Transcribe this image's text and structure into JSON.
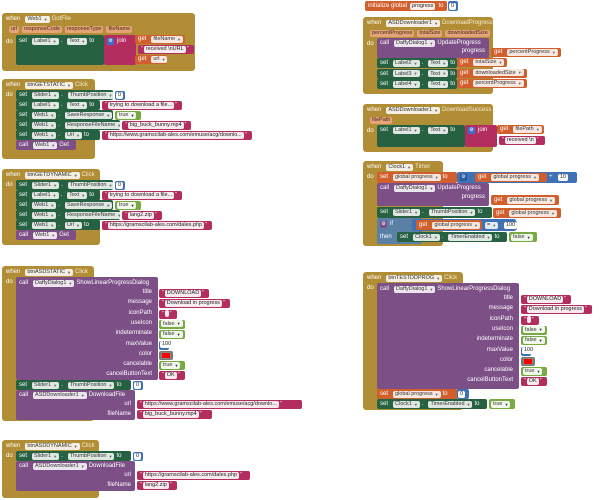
{
  "colors": {
    "event": "#b18e35",
    "setter": "#266141",
    "call": "#7d4f87",
    "text": "#b32d5e",
    "variable": "#d05f2d",
    "math": "#3f71b5",
    "logic": "#77ab41",
    "color_red": "#ff0000"
  },
  "kw": {
    "when": "when",
    "do": "do",
    "set": "set",
    "to": "to",
    "call": "call",
    "get": "get",
    "join": "join",
    "then": "then",
    "if": "if",
    "dot": ".",
    "quote": "\"",
    "initialize_global": "initialize global",
    "plus": "+",
    "eq": "="
  },
  "web_gotfile": {
    "component": "Web1",
    "event": "GotFile",
    "params": [
      "url",
      "responseCode",
      "responseType",
      "fileName"
    ],
    "set_component": "Label1",
    "set_property": "Text",
    "join_items": [
      {
        "type": "get",
        "value": "fileName"
      },
      {
        "type": "text",
        "value": "received \\nURL"
      },
      {
        "type": "get",
        "value": "url"
      }
    ]
  },
  "btn_get_static": {
    "component": "btnGETSTATIC",
    "event": "Click",
    "statements": [
      {
        "component": "Slider1",
        "property": "ThumbPosition",
        "value": "0",
        "type": "number"
      },
      {
        "component": "Label1",
        "property": "Text",
        "value": "trying to download a file...",
        "type": "text"
      },
      {
        "component": "Web1",
        "property": "SaveResponse",
        "value": "true",
        "type": "bool"
      },
      {
        "component": "Web1",
        "property": "ResponseFileName",
        "value": "big_buck_bunny.mp4",
        "type": "text"
      },
      {
        "component": "Web1",
        "property": "Url",
        "value": "https://www.gramscilab-ales.com/emuse/acg/downlo...",
        "type": "text"
      }
    ],
    "call_component": "Web1",
    "call_method": "Get"
  },
  "btn_get_dynamic": {
    "component": "btnGETDYNAMIC",
    "event": "Click",
    "statements": [
      {
        "component": "Slider1",
        "property": "ThumbPosition",
        "value": "0",
        "type": "number"
      },
      {
        "component": "Label1",
        "property": "Text",
        "value": "trying to download a file...",
        "type": "text"
      },
      {
        "component": "Web1",
        "property": "SaveResponse",
        "value": "true",
        "type": "bool"
      },
      {
        "component": "Web1",
        "property": "ResponseFileName",
        "value": "lang2.zip",
        "type": "text"
      },
      {
        "component": "Web1",
        "property": "Url",
        "value": "https://gramscilab-ales.com/dales.php",
        "type": "text"
      }
    ],
    "call_component": "Web1",
    "call_method": "Get"
  },
  "btn_asd_static": {
    "component": "btnASDSTATIC",
    "event": "Click",
    "dialog_component": "DaffyDialog1",
    "dialog_method": "ShowLinearProgressDialog",
    "dialog_args": [
      {
        "name": "title",
        "value": "DOWNLOAD",
        "type": "text"
      },
      {
        "name": "message",
        "value": "Download in progress",
        "type": "text"
      },
      {
        "name": "iconPath",
        "value": "",
        "type": "text"
      },
      {
        "name": "useIcon",
        "value": "false",
        "type": "bool"
      },
      {
        "name": "indeterminate",
        "value": "false",
        "type": "bool"
      },
      {
        "name": "maxValue",
        "value": "100",
        "type": "number"
      },
      {
        "name": "color",
        "value": "#ff0000",
        "type": "color"
      },
      {
        "name": "cancelable",
        "value": "true",
        "type": "bool"
      },
      {
        "name": "cancelButtonText",
        "value": "OK",
        "type": "text"
      }
    ],
    "set_component": "Slider1",
    "set_property": "ThumbPosition",
    "set_value": "0",
    "download_component": "ASDDownloader1",
    "download_method": "DownloadFile",
    "download_args": [
      {
        "name": "url",
        "value": "https://www.gramscilab-ales.com/emuse/acg/downlo..."
      },
      {
        "name": "fileName",
        "value": "big_buck_bunny.mp4"
      }
    ]
  },
  "btn_asd_dynamic": {
    "component": "btnASDDYNAMIC",
    "event": "Click",
    "set_component": "Slider1",
    "set_property": "ThumbPosition",
    "set_value": "0",
    "download_component": "ASDDownloader1",
    "download_method": "DownloadFile",
    "download_args": [
      {
        "name": "url",
        "value": "https://gramscilab-ales.com/dales.php"
      },
      {
        "name": "fileName",
        "value": "lang2.zip"
      }
    ]
  },
  "global_init": {
    "name": "progress",
    "value": "0"
  },
  "download_progress": {
    "component": "ASDDownloader1",
    "event": "DownloadProgress",
    "params": [
      "percentProgress",
      "totalSize",
      "downloadedSize"
    ],
    "call_component": "DaffyDialog1",
    "call_method": "UpdateProgress",
    "call_arg_name": "progress",
    "call_arg_value": "percentProgress",
    "sets": [
      {
        "component": "Label2",
        "property": "Text",
        "get": "totalSize"
      },
      {
        "component": "Label3",
        "property": "Text",
        "get": "downloadedSize"
      },
      {
        "component": "Label4",
        "property": "Text",
        "get": "percentProgress"
      }
    ]
  },
  "download_success": {
    "component": "ASDDownloader1",
    "event": "DownloadSuccess",
    "params": [
      "filePath"
    ],
    "set_component": "Label1",
    "set_property": "Text",
    "join_get": "filePath",
    "join_text": "received \\n"
  },
  "clock_timer": {
    "component": "Clock1",
    "event": "Timer",
    "var": "global progress",
    "add_value": "10",
    "call_component": "DaffyDialog1",
    "call_method": "UpdateProgress",
    "call_arg_name": "progress",
    "slider_component": "Slider1",
    "slider_property": "ThumbPosition",
    "compare_value": "100",
    "then_component": "Clock1",
    "then_property": "TimerEnabled",
    "then_value": "false"
  },
  "btn_test_prog": {
    "component": "btnTESTDDPROG",
    "event": "Click",
    "dialog_component": "DaffyDialog1",
    "dialog_method": "ShowLinearProgressDialog",
    "dialog_args": [
      {
        "name": "title",
        "value": "DOWNLOAD",
        "type": "text"
      },
      {
        "name": "message",
        "value": "Download in progress",
        "type": "text"
      },
      {
        "name": "iconPath",
        "value": "",
        "type": "text"
      },
      {
        "name": "useIcon",
        "value": "false",
        "type": "bool"
      },
      {
        "name": "indeterminate",
        "value": "false",
        "type": "bool"
      },
      {
        "name": "maxValue",
        "value": "100",
        "type": "number"
      },
      {
        "name": "color",
        "value": "#ff0000",
        "type": "color"
      },
      {
        "name": "cancelable",
        "value": "true",
        "type": "bool"
      },
      {
        "name": "cancelButtonText",
        "value": "OK",
        "type": "text"
      }
    ],
    "set_var": "global progress",
    "set_var_value": "0",
    "clock_component": "Clock1",
    "clock_property": "TimerEnabled",
    "clock_value": "true"
  }
}
